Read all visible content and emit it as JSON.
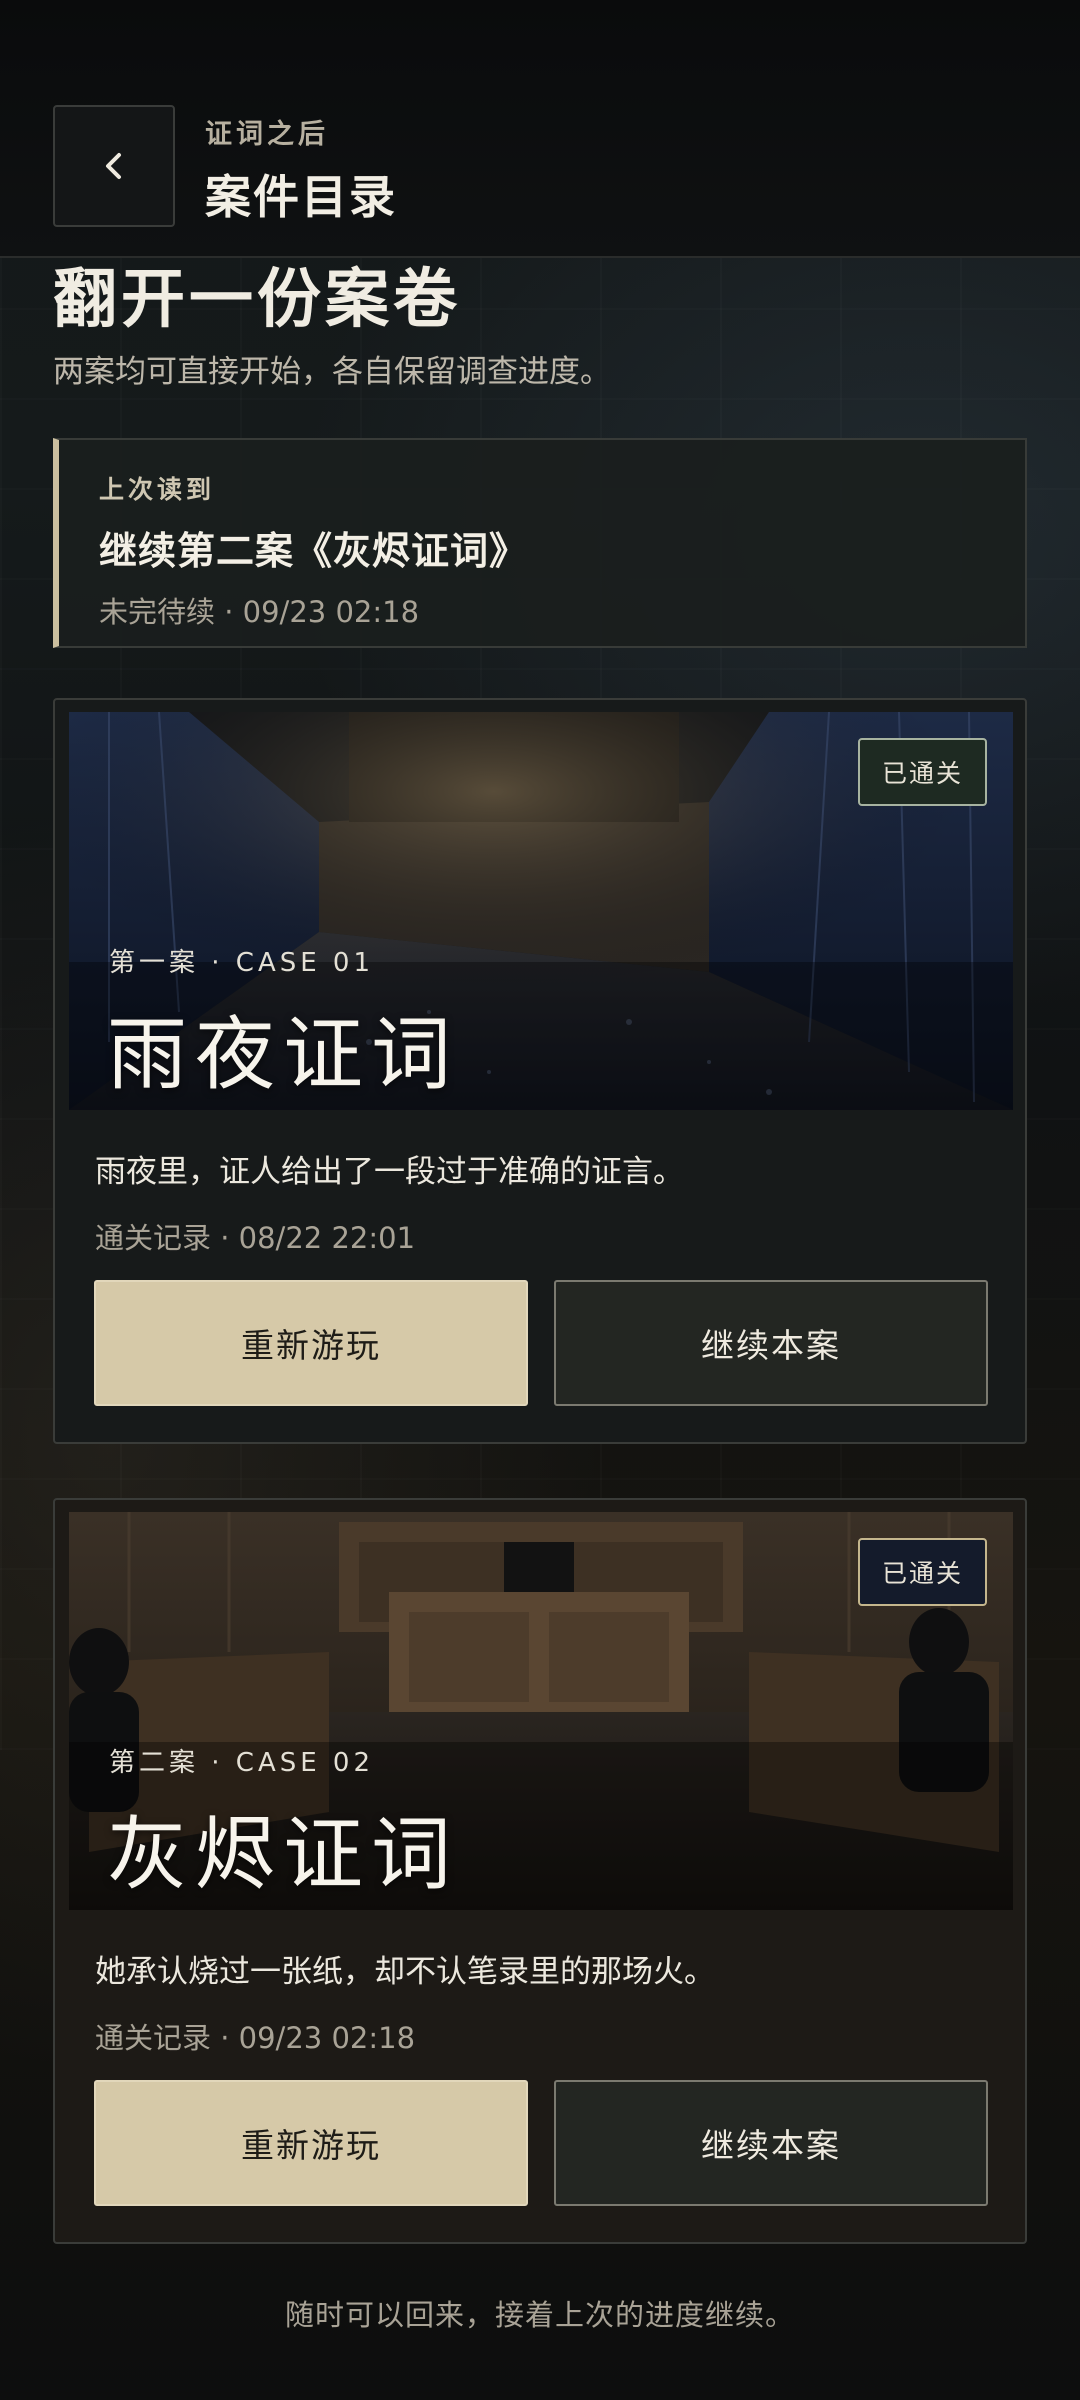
{
  "header": {
    "subtitle": "证词之后",
    "title": "案件目录"
  },
  "hero": {
    "title": "翻开一份案卷",
    "subtitle": "两案均可直接开始，各自保留调查进度。"
  },
  "last_read": {
    "tag": "上次读到",
    "title": "继续第二案《灰烬证词》",
    "meta": "未完待续 · 09/23 02:18"
  },
  "cases": [
    {
      "badge": "已通关",
      "label": "第一案 · CASE 01",
      "name": "雨夜证词",
      "description": "雨夜里，证人给出了一段过于准确的证言。",
      "record": "通关记录 · 08/22 22:01",
      "replay_label": "重新游玩",
      "continue_label": "继续本案"
    },
    {
      "badge": "已通关",
      "label": "第二案 · CASE 02",
      "name": "灰烬证词",
      "description": "她承认烧过一张纸，却不认笔录里的那场火。",
      "record": "通关记录 · 09/23 02:18",
      "replay_label": "重新游玩",
      "continue_label": "继续本案"
    }
  ],
  "footer": {
    "note": "随时可以回来，接着上次的进度继续。"
  },
  "icons": {
    "back": "chevron-left-icon"
  },
  "colors": {
    "accent": "#d6c9a8",
    "background": "#0c0e0f"
  }
}
